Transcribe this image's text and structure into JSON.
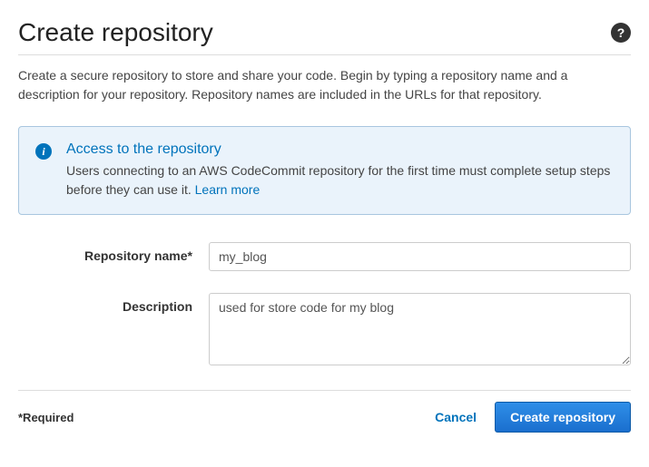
{
  "header": {
    "title": "Create repository"
  },
  "intro": "Create a secure repository to store and share your code. Begin by typing a repository name and a description for your repository. Repository names are included in the URLs for that repository.",
  "infoBox": {
    "title": "Access to the repository",
    "body": "Users connecting to an AWS CodeCommit repository for the first time must complete setup steps before they can use it. ",
    "linkText": "Learn more"
  },
  "form": {
    "repoNameLabel": "Repository name*",
    "repoNameValue": "my_blog",
    "descriptionLabel": "Description",
    "descriptionValue": "used for store code for my blog"
  },
  "footer": {
    "requiredNote": "*Required",
    "cancelLabel": "Cancel",
    "submitLabel": "Create repository"
  }
}
